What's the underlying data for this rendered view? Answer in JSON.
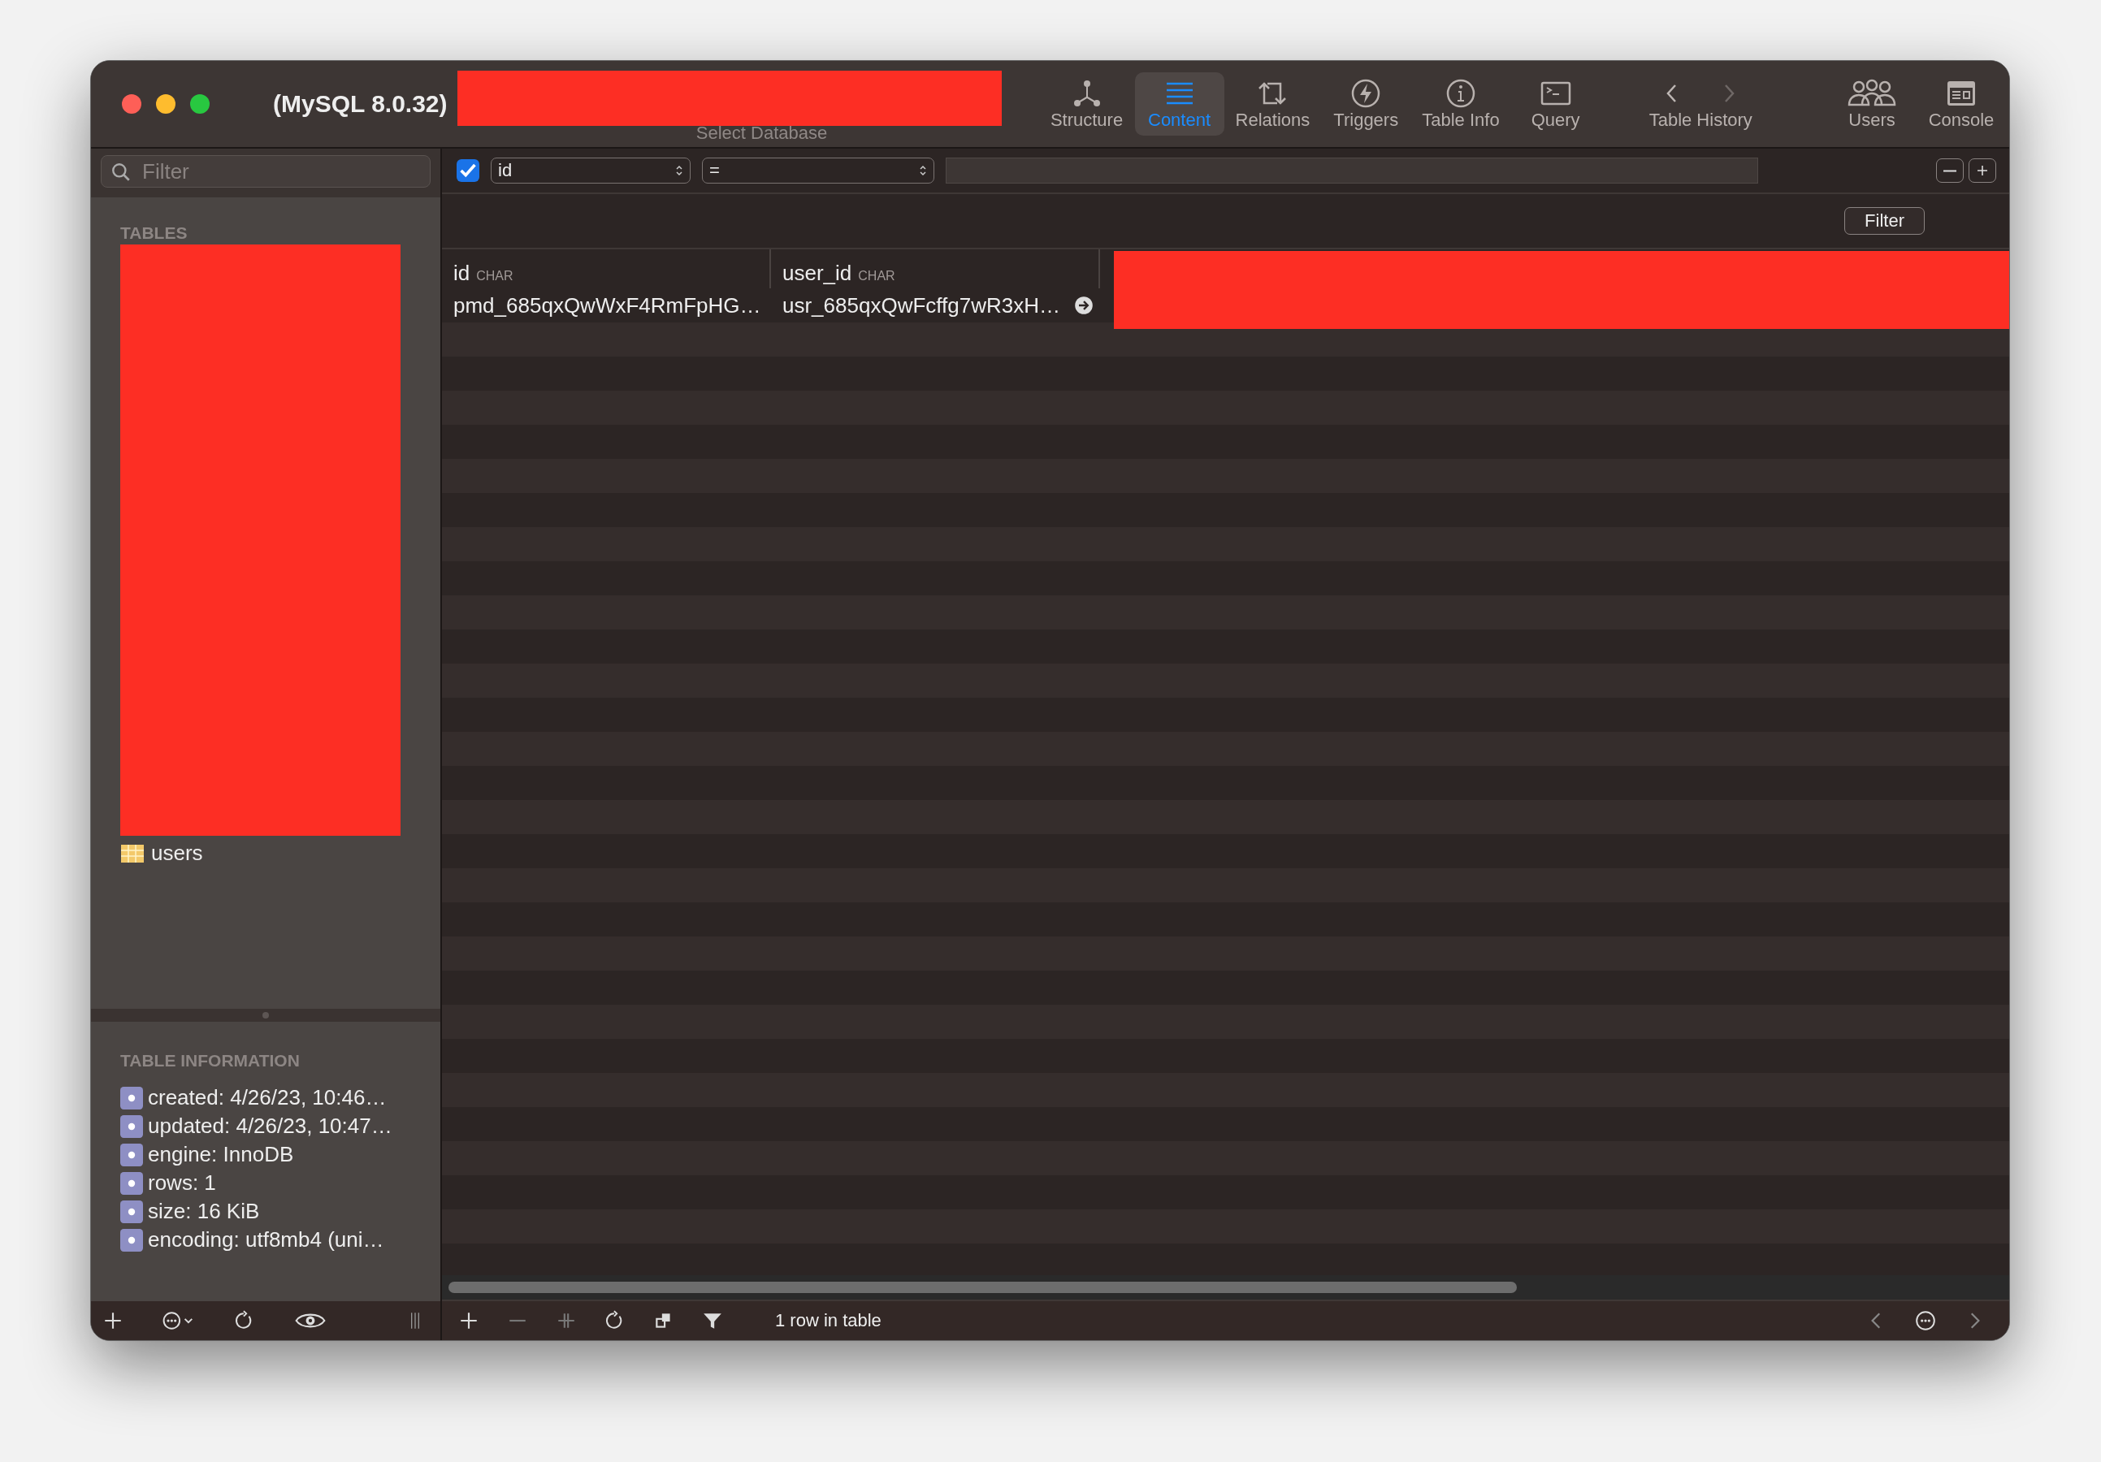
{
  "window": {
    "title": "(MySQL 8.0.32)",
    "database_label": "Select Database"
  },
  "toolbar": {
    "items": [
      {
        "label": "Structure",
        "selected": false
      },
      {
        "label": "Content",
        "selected": true
      },
      {
        "label": "Relations",
        "selected": false
      },
      {
        "label": "Triggers",
        "selected": false
      },
      {
        "label": "Table Info",
        "selected": false
      },
      {
        "label": "Query",
        "selected": false
      }
    ],
    "history": {
      "label": "Table History"
    },
    "right": [
      {
        "label": "Users"
      },
      {
        "label": "Console"
      }
    ]
  },
  "sidebar": {
    "filter": {
      "placeholder": "Filter"
    },
    "tables_heading": "TABLES",
    "tables": [
      {
        "name": "users"
      }
    ],
    "info_heading": "TABLE INFORMATION",
    "info": [
      "created: 4/26/23, 10:46…",
      "updated: 4/26/23, 10:47…",
      "engine: InnoDB",
      "rows: 1",
      "size: 16 KiB",
      "encoding: utf8mb4 (uni…"
    ]
  },
  "filter_bar": {
    "enabled": true,
    "column": "id",
    "operator": "=",
    "button": "Filter"
  },
  "table": {
    "columns": [
      {
        "name": "id",
        "type": "CHAR"
      },
      {
        "name": "user_id",
        "type": "CHAR"
      }
    ],
    "rows": [
      [
        "pmd_685qxQwWxF4RmFpHG…",
        "usr_685qxQwFcffg7wR3xH…"
      ]
    ]
  },
  "status_bar": {
    "text": "1 row in table"
  }
}
